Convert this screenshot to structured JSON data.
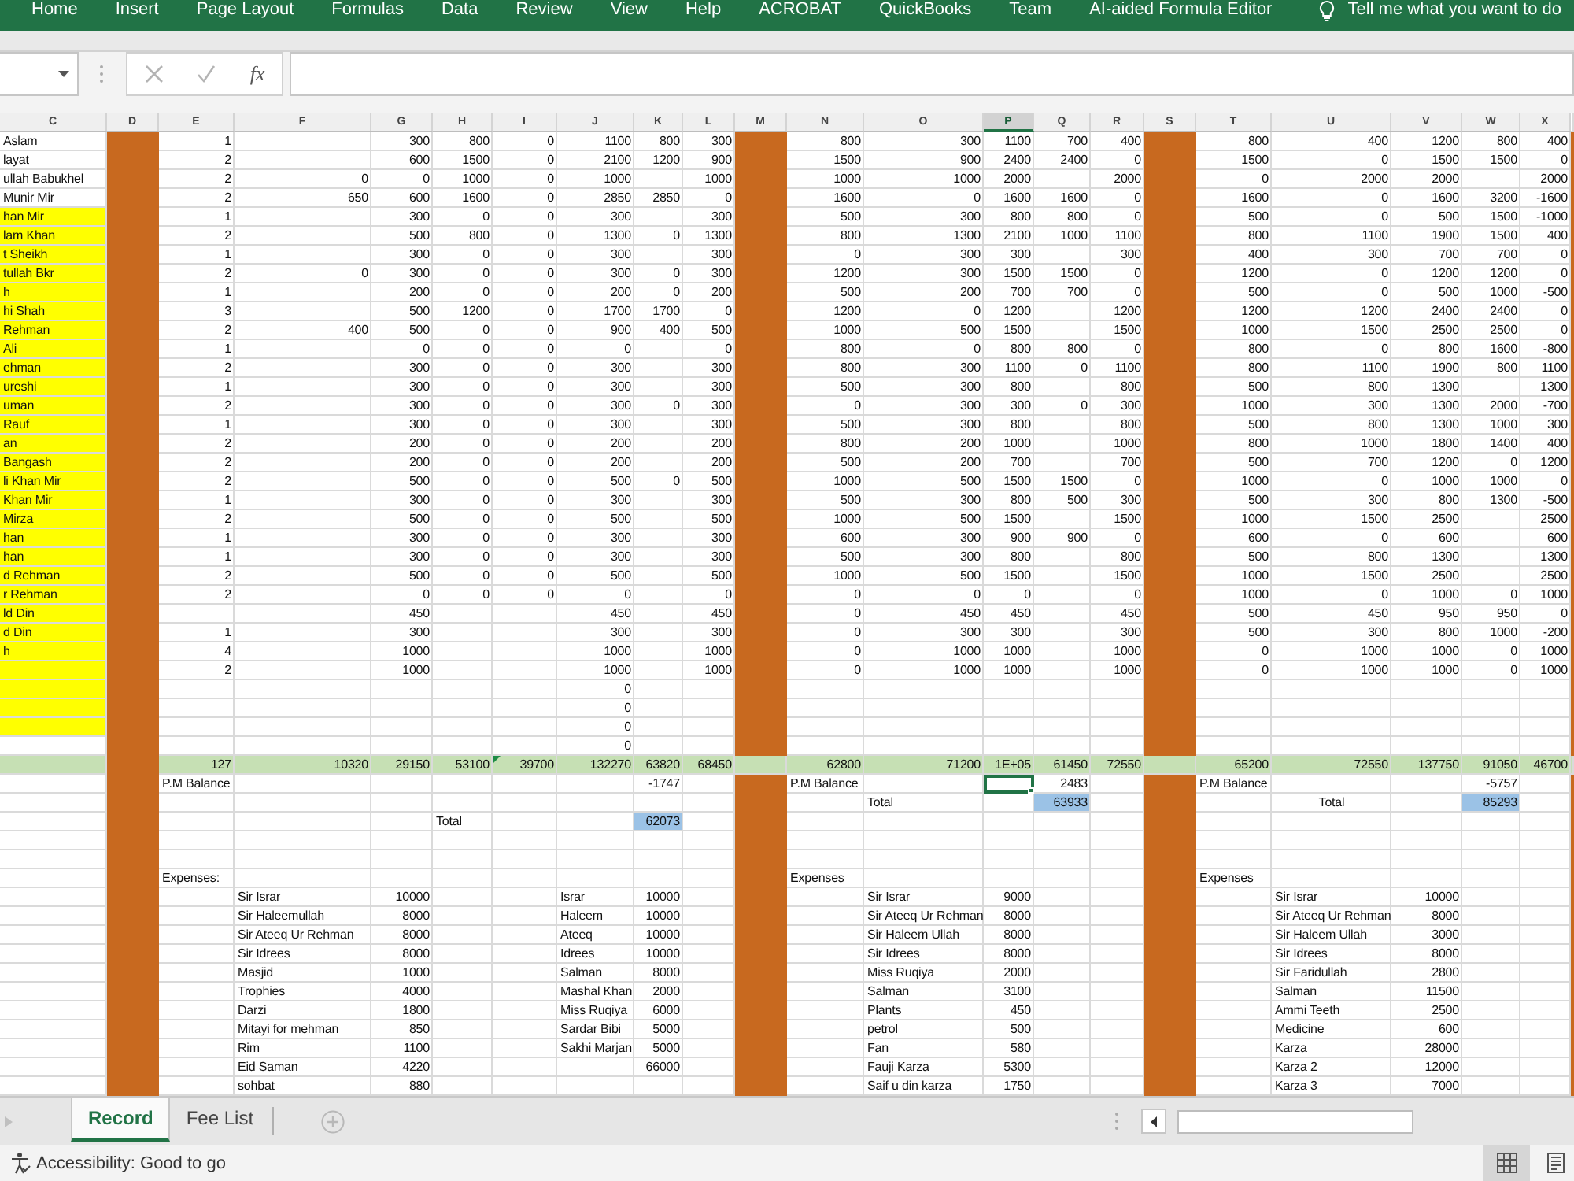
{
  "ribbon": {
    "tabs": [
      {
        "label": "Home",
        "selected": false
      },
      {
        "label": "Insert",
        "selected": false
      },
      {
        "label": "Page Layout",
        "selected": false
      },
      {
        "label": "Formulas",
        "selected": false
      },
      {
        "label": "Data",
        "selected": false
      },
      {
        "label": "Review",
        "selected": false
      },
      {
        "label": "View",
        "selected": false
      },
      {
        "label": "Help",
        "selected": false
      },
      {
        "label": "ACROBAT",
        "selected": false
      },
      {
        "label": "QuickBooks",
        "selected": false
      },
      {
        "label": "Team",
        "selected": false
      },
      {
        "label": "AI-aided Formula Editor",
        "selected": false
      }
    ],
    "tell_me": "Tell me what you want to do"
  },
  "formula_bar": {
    "function_label": "fx"
  },
  "sheet": {
    "columns": [
      {
        "label": "C",
        "kind": "text",
        "selected": false
      },
      {
        "label": "D",
        "kind": "divider",
        "interrupted_by_totals": false,
        "selected": false
      },
      {
        "label": "E",
        "kind": "number",
        "selected": false
      },
      {
        "label": "F",
        "kind": "number",
        "selected": false
      },
      {
        "label": "G",
        "kind": "number",
        "selected": false
      },
      {
        "label": "H",
        "kind": "number",
        "selected": false
      },
      {
        "label": "I",
        "kind": "number",
        "selected": false
      },
      {
        "label": "J",
        "kind": "number",
        "selected": false
      },
      {
        "label": "K",
        "kind": "number",
        "selected": false
      },
      {
        "label": "L",
        "kind": "number",
        "selected": false
      },
      {
        "label": "M",
        "kind": "divider",
        "interrupted_by_totals": true,
        "selected": false
      },
      {
        "label": "N",
        "kind": "number",
        "selected": false
      },
      {
        "label": "O",
        "kind": "number",
        "selected": false
      },
      {
        "label": "P",
        "kind": "number",
        "selected": true
      },
      {
        "label": "Q",
        "kind": "number",
        "selected": false
      },
      {
        "label": "R",
        "kind": "number",
        "selected": false
      },
      {
        "label": "S",
        "kind": "divider",
        "interrupted_by_totals": true,
        "selected": false
      },
      {
        "label": "T",
        "kind": "number",
        "selected": false
      },
      {
        "label": "U",
        "kind": "number",
        "selected": false
      },
      {
        "label": "V",
        "kind": "number",
        "selected": false
      },
      {
        "label": "W",
        "kind": "number",
        "selected": false
      },
      {
        "label": "X",
        "kind": "number",
        "selected": false
      },
      {
        "kind": "divider",
        "interrupted_by_totals": true
      }
    ],
    "rows": [
      {
        "kind": "entry",
        "cells": [
          "Aslam",
          "1",
          null,
          "300",
          "800",
          "0",
          "1100",
          "800",
          "300",
          "800",
          "300",
          "1100",
          "700",
          "400",
          "800",
          "400",
          "1200",
          "800",
          "400"
        ]
      },
      {
        "kind": "entry",
        "cells": [
          "layat",
          "2",
          null,
          "600",
          "1500",
          "0",
          "2100",
          "1200",
          "900",
          "1500",
          "900",
          "2400",
          "2400",
          "0",
          "1500",
          "0",
          "1500",
          "1500",
          "0"
        ]
      },
      {
        "kind": "entry",
        "cells": [
          "ullah Babukhel",
          "2",
          "0",
          "0",
          "1000",
          "0",
          "1000",
          null,
          "1000",
          "1000",
          "1000",
          "2000",
          null,
          "2000",
          "0",
          "2000",
          "2000",
          null,
          "2000"
        ]
      },
      {
        "kind": "entry",
        "cells": [
          "Munir Mir",
          "2",
          "650",
          "600",
          "1600",
          "0",
          "2850",
          "2850",
          "0",
          "1600",
          "0",
          "1600",
          "1600",
          "0",
          "1600",
          "0",
          "1600",
          "3200",
          "-1600"
        ]
      },
      {
        "kind": "entry",
        "cells": [
          {
            "text": "han Mir",
            "color": "#ffff00"
          },
          "1",
          null,
          "300",
          "0",
          "0",
          "300",
          null,
          "300",
          "500",
          "300",
          "800",
          "800",
          "0",
          "500",
          "0",
          "500",
          "1500",
          "-1000"
        ]
      },
      {
        "kind": "entry",
        "cells": [
          {
            "text": "lam Khan",
            "color": "#ffff00"
          },
          "2",
          null,
          "500",
          "800",
          "0",
          "1300",
          "0",
          "1300",
          "800",
          "1300",
          "2100",
          "1000",
          "1100",
          "800",
          "1100",
          "1900",
          "1500",
          "400"
        ]
      },
      {
        "kind": "entry",
        "cells": [
          {
            "text": "t Sheikh",
            "color": "#ffff00"
          },
          "1",
          null,
          "300",
          "0",
          "0",
          "300",
          null,
          "300",
          "0",
          "300",
          "300",
          null,
          "300",
          "400",
          "300",
          "700",
          "700",
          "0"
        ]
      },
      {
        "kind": "entry",
        "cells": [
          {
            "text": "tullah Bkr",
            "color": "#ffff00"
          },
          "2",
          "0",
          "300",
          "0",
          "0",
          "300",
          "0",
          "300",
          "1200",
          "300",
          "1500",
          "1500",
          "0",
          "1200",
          "0",
          "1200",
          "1200",
          "0"
        ]
      },
      {
        "kind": "entry",
        "cells": [
          {
            "text": "h",
            "color": "#ffff00"
          },
          "1",
          null,
          "200",
          "0",
          "0",
          "200",
          "0",
          "200",
          "500",
          "200",
          "700",
          "700",
          "0",
          "500",
          "0",
          "500",
          "1000",
          "-500"
        ]
      },
      {
        "kind": "entry",
        "cells": [
          {
            "text": "hi Shah",
            "color": "#ffff00"
          },
          "3",
          null,
          "500",
          "1200",
          "0",
          "1700",
          "1700",
          "0",
          "1200",
          "0",
          "1200",
          null,
          "1200",
          "1200",
          "1200",
          "2400",
          "2400",
          "0"
        ]
      },
      {
        "kind": "entry",
        "cells": [
          {
            "text": "Rehman",
            "color": "#ffff00"
          },
          "2",
          "400",
          "500",
          "0",
          "0",
          "900",
          "400",
          "500",
          "1000",
          "500",
          "1500",
          null,
          "1500",
          "1000",
          "1500",
          "2500",
          "2500",
          "0"
        ]
      },
      {
        "kind": "entry",
        "cells": [
          {
            "text": "Ali",
            "color": "#ffff00"
          },
          "1",
          null,
          "0",
          "0",
          "0",
          "0",
          null,
          "0",
          "800",
          "0",
          "800",
          "800",
          "0",
          "800",
          "0",
          "800",
          "1600",
          "-800"
        ]
      },
      {
        "kind": "entry",
        "cells": [
          {
            "text": "ehman",
            "color": "#ffff00"
          },
          "2",
          null,
          "300",
          "0",
          "0",
          "300",
          null,
          "300",
          "800",
          "300",
          "1100",
          "0",
          "1100",
          "800",
          "1100",
          "1900",
          "800",
          "1100"
        ]
      },
      {
        "kind": "entry",
        "cells": [
          {
            "text": "ureshi",
            "color": "#ffff00"
          },
          "1",
          null,
          "300",
          "0",
          "0",
          "300",
          null,
          "300",
          "500",
          "300",
          "800",
          null,
          "800",
          "500",
          "800",
          "1300",
          null,
          "1300"
        ]
      },
      {
        "kind": "entry",
        "cells": [
          {
            "text": "uman",
            "color": "#ffff00"
          },
          "2",
          null,
          "300",
          "0",
          "0",
          "300",
          "0",
          "300",
          "0",
          "300",
          "300",
          "0",
          "300",
          "1000",
          "300",
          "1300",
          "2000",
          "-700"
        ]
      },
      {
        "kind": "entry",
        "cells": [
          {
            "text": "Rauf",
            "color": "#ffff00"
          },
          "1",
          null,
          "300",
          "0",
          "0",
          "300",
          null,
          "300",
          "500",
          "300",
          "800",
          null,
          "800",
          "500",
          "800",
          "1300",
          "1000",
          "300"
        ]
      },
      {
        "kind": "entry",
        "cells": [
          {
            "text": "an",
            "color": "#ffff00"
          },
          "2",
          null,
          "200",
          "0",
          "0",
          "200",
          null,
          "200",
          "800",
          "200",
          "1000",
          null,
          "1000",
          "800",
          "1000",
          "1800",
          "1400",
          "400"
        ]
      },
      {
        "kind": "entry",
        "cells": [
          {
            "text": "Bangash",
            "color": "#ffff00"
          },
          "2",
          null,
          "200",
          "0",
          "0",
          "200",
          null,
          "200",
          "500",
          "200",
          "700",
          null,
          "700",
          "500",
          "700",
          "1200",
          "0",
          "1200"
        ]
      },
      {
        "kind": "entry",
        "cells": [
          {
            "text": "li Khan Mir",
            "color": "#ffff00"
          },
          "2",
          null,
          "500",
          "0",
          "0",
          "500",
          "0",
          "500",
          "1000",
          "500",
          "1500",
          "1500",
          "0",
          "1000",
          "0",
          "1000",
          "1000",
          "0"
        ]
      },
      {
        "kind": "entry",
        "cells": [
          {
            "text": "Khan Mir",
            "color": "#ffff00"
          },
          "1",
          null,
          "300",
          "0",
          "0",
          "300",
          null,
          "300",
          "500",
          "300",
          "800",
          "500",
          "300",
          "500",
          "300",
          "800",
          "1300",
          "-500"
        ]
      },
      {
        "kind": "entry",
        "cells": [
          {
            "text": "Mirza",
            "color": "#ffff00"
          },
          "2",
          null,
          "500",
          "0",
          "0",
          "500",
          null,
          "500",
          "1000",
          "500",
          "1500",
          null,
          "1500",
          "1000",
          "1500",
          "2500",
          null,
          "2500"
        ]
      },
      {
        "kind": "entry",
        "cells": [
          {
            "text": "han",
            "color": "#ffff00"
          },
          "1",
          null,
          "300",
          "0",
          "0",
          "300",
          null,
          "300",
          "600",
          "300",
          "900",
          "900",
          "0",
          "600",
          "0",
          "600",
          null,
          "600"
        ]
      },
      {
        "kind": "entry",
        "cells": [
          {
            "text": "han",
            "color": "#ffff00"
          },
          "1",
          null,
          "300",
          "0",
          "0",
          "300",
          null,
          "300",
          "500",
          "300",
          "800",
          null,
          "800",
          "500",
          "800",
          "1300",
          null,
          "1300"
        ]
      },
      {
        "kind": "entry",
        "cells": [
          {
            "text": "d Rehman",
            "color": "#ffff00"
          },
          "2",
          null,
          "500",
          "0",
          "0",
          "500",
          null,
          "500",
          "1000",
          "500",
          "1500",
          null,
          "1500",
          "1000",
          "1500",
          "2500",
          null,
          "2500"
        ]
      },
      {
        "kind": "entry",
        "cells": [
          {
            "text": "r Rehman",
            "color": "#ffff00"
          },
          "2",
          null,
          "0",
          "0",
          "0",
          "0",
          null,
          "0",
          "0",
          "0",
          "0",
          null,
          "0",
          "1000",
          "0",
          "1000",
          "0",
          "1000"
        ]
      },
      {
        "kind": "entry",
        "cells": [
          {
            "text": "ld Din",
            "color": "#ffff00"
          },
          null,
          null,
          "450",
          null,
          null,
          "450",
          null,
          "450",
          "0",
          "450",
          "450",
          null,
          "450",
          "500",
          "450",
          "950",
          "950",
          "0"
        ]
      },
      {
        "kind": "entry",
        "cells": [
          {
            "text": "d Din",
            "color": "#ffff00"
          },
          "1",
          null,
          "300",
          null,
          null,
          "300",
          null,
          "300",
          "0",
          "300",
          "300",
          null,
          "300",
          "500",
          "300",
          "800",
          "1000",
          "-200"
        ]
      },
      {
        "kind": "entry",
        "cells": [
          {
            "text": "h",
            "color": "#ffff00"
          },
          "4",
          null,
          "1000",
          null,
          null,
          "1000",
          null,
          "1000",
          "0",
          "1000",
          "1000",
          null,
          "1000",
          "0",
          "1000",
          "1000",
          "0",
          "1000"
        ]
      },
      {
        "kind": "entry",
        "cells": [
          {
            "color": "#ffff00"
          },
          "2",
          null,
          "1000",
          null,
          null,
          "1000",
          null,
          "1000",
          "0",
          "1000",
          "1000",
          null,
          "1000",
          "0",
          "1000",
          "1000",
          "0",
          "1000"
        ]
      },
      {
        "kind": "entry",
        "cells": [
          {
            "color": "#ffff00"
          },
          null,
          null,
          null,
          null,
          null,
          "0"
        ]
      },
      {
        "kind": "entry",
        "cells": [
          {
            "color": "#ffff00"
          },
          null,
          null,
          null,
          null,
          null,
          "0"
        ]
      },
      {
        "kind": "entry",
        "cells": [
          {
            "color": "#ffff00"
          },
          null,
          null,
          null,
          null,
          null,
          "0"
        ]
      },
      {
        "kind": "entry",
        "cells": [
          null,
          null,
          null,
          null,
          null,
          null,
          "0"
        ]
      },
      {
        "kind": "total",
        "cells": [
          null,
          "127",
          "10320",
          "29150",
          "53100",
          {
            "text": "39700",
            "flagged": true
          },
          "132270",
          "63820",
          "68450",
          "62800",
          "71200",
          "1E+05",
          "61450",
          "72550",
          "65200",
          "72550",
          "137750",
          "91050",
          "46700"
        ]
      },
      {
        "kind": "entry",
        "cells": [
          null,
          {
            "text": "P.M Balance",
            "kind": "label"
          },
          null,
          null,
          null,
          null,
          null,
          "-1747",
          null,
          {
            "text": "P.M Balance",
            "kind": "label"
          },
          null,
          {
            "selected": true
          },
          "2483",
          null,
          {
            "text": "P.M Balance",
            "kind": "label"
          },
          null,
          null,
          "-5757"
        ]
      },
      {
        "kind": "entry",
        "cells": [
          null,
          null,
          null,
          null,
          null,
          null,
          null,
          null,
          null,
          null,
          {
            "text": "Total",
            "kind": "label"
          },
          null,
          {
            "text": "63933",
            "color": "#9bc2e6"
          },
          null,
          null,
          {
            "text": "Total",
            "kind": "caption"
          },
          null,
          {
            "text": "85293",
            "color": "#9bc2e6"
          }
        ]
      },
      {
        "kind": "entry",
        "cells": [
          null,
          null,
          null,
          null,
          {
            "text": "Total",
            "kind": "label"
          },
          null,
          null,
          {
            "text": "62073",
            "color": "#9bc2e6"
          }
        ]
      },
      {
        "kind": "entry"
      },
      {
        "kind": "entry"
      },
      {
        "kind": "entry",
        "cells": [
          null,
          {
            "text": "Expenses:",
            "kind": "label"
          },
          null,
          null,
          null,
          null,
          null,
          null,
          null,
          {
            "text": "Expenses",
            "kind": "label"
          },
          null,
          null,
          null,
          null,
          {
            "text": "Expenses",
            "kind": "label"
          }
        ]
      },
      {
        "kind": "entry",
        "cells": [
          null,
          null,
          {
            "text": "Sir Israr",
            "kind": "label"
          },
          "10000",
          null,
          null,
          {
            "text": "Israr",
            "kind": "label"
          },
          "10000",
          null,
          null,
          {
            "text": "Sir Israr",
            "kind": "label"
          },
          "9000",
          null,
          null,
          null,
          {
            "text": "Sir Israr",
            "kind": "label"
          },
          "10000"
        ]
      },
      {
        "kind": "entry",
        "cells": [
          null,
          null,
          {
            "text": "Sir Haleemullah",
            "kind": "label"
          },
          "8000",
          null,
          null,
          {
            "text": "Haleem",
            "kind": "label"
          },
          "10000",
          null,
          null,
          {
            "text": "Sir Ateeq Ur Rehman",
            "kind": "label"
          },
          "8000",
          null,
          null,
          null,
          {
            "text": "Sir Ateeq Ur Rehman",
            "kind": "label"
          },
          "8000"
        ]
      },
      {
        "kind": "entry",
        "cells": [
          null,
          null,
          {
            "text": "Sir Ateeq Ur Rehman",
            "kind": "label"
          },
          "8000",
          null,
          null,
          {
            "text": "Ateeq",
            "kind": "label"
          },
          "10000",
          null,
          null,
          {
            "text": "Sir Haleem Ullah",
            "kind": "label"
          },
          "8000",
          null,
          null,
          null,
          {
            "text": "Sir Haleem Ullah",
            "kind": "label"
          },
          "3000"
        ]
      },
      {
        "kind": "entry",
        "cells": [
          null,
          null,
          {
            "text": "Sir Idrees",
            "kind": "label"
          },
          "8000",
          null,
          null,
          {
            "text": "Idrees",
            "kind": "label"
          },
          "10000",
          null,
          null,
          {
            "text": "Sir Idrees",
            "kind": "label"
          },
          "8000",
          null,
          null,
          null,
          {
            "text": "Sir Idrees",
            "kind": "label"
          },
          "8000"
        ]
      },
      {
        "kind": "entry",
        "cells": [
          null,
          null,
          {
            "text": "Masjid",
            "kind": "label"
          },
          "1000",
          null,
          null,
          {
            "text": "Salman",
            "kind": "label"
          },
          "8000",
          null,
          null,
          {
            "text": "Miss Ruqiya",
            "kind": "label"
          },
          "2000",
          null,
          null,
          null,
          {
            "text": "Sir Faridullah",
            "kind": "label"
          },
          "2800"
        ]
      },
      {
        "kind": "entry",
        "cells": [
          null,
          null,
          {
            "text": "Trophies",
            "kind": "label"
          },
          "4000",
          null,
          null,
          {
            "text": "Mashal Khan",
            "kind": "label"
          },
          "2000",
          null,
          null,
          {
            "text": "Salman",
            "kind": "label"
          },
          "3100",
          null,
          null,
          null,
          {
            "text": "Salman",
            "kind": "label"
          },
          "11500"
        ]
      },
      {
        "kind": "entry",
        "cells": [
          null,
          null,
          {
            "text": "Darzi",
            "kind": "label"
          },
          "1800",
          null,
          null,
          {
            "text": "Miss Ruqiya",
            "kind": "label"
          },
          "6000",
          null,
          null,
          {
            "text": "Plants",
            "kind": "label"
          },
          "450",
          null,
          null,
          null,
          {
            "text": "Ammi Teeth",
            "kind": "label"
          },
          "2500"
        ]
      },
      {
        "kind": "entry",
        "cells": [
          null,
          null,
          {
            "text": "Mitayi for mehman",
            "kind": "label"
          },
          "850",
          null,
          null,
          {
            "text": "Sardar Bibi",
            "kind": "label"
          },
          "5000",
          null,
          null,
          {
            "text": "petrol",
            "kind": "label"
          },
          "500",
          null,
          null,
          null,
          {
            "text": "Medicine",
            "kind": "label"
          },
          "600"
        ]
      },
      {
        "kind": "entry",
        "cells": [
          null,
          null,
          {
            "text": "Rim",
            "kind": "label"
          },
          "1100",
          null,
          null,
          {
            "text": "Sakhi Marjan",
            "kind": "label"
          },
          "5000",
          null,
          null,
          {
            "text": "Fan",
            "kind": "label"
          },
          "580",
          null,
          null,
          null,
          {
            "text": "Karza",
            "kind": "label"
          },
          "28000"
        ]
      },
      {
        "kind": "entry",
        "cells": [
          null,
          null,
          {
            "text": "Eid Saman",
            "kind": "label"
          },
          "4220",
          null,
          null,
          null,
          "66000",
          null,
          null,
          {
            "text": "Fauji Karza",
            "kind": "label"
          },
          "5300",
          null,
          null,
          null,
          {
            "text": "Karza 2",
            "kind": "label"
          },
          "12000"
        ]
      },
      {
        "kind": "entry",
        "cells": [
          null,
          null,
          {
            "text": "sohbat",
            "kind": "label"
          },
          "880",
          null,
          null,
          null,
          null,
          null,
          null,
          {
            "text": "Saif u din karza",
            "kind": "label"
          },
          "1750",
          null,
          null,
          null,
          {
            "text": "Karza 3",
            "kind": "label"
          },
          "7000"
        ]
      }
    ]
  },
  "sheet_tabs": [
    {
      "label": "Record",
      "selected": true
    },
    {
      "label": "Fee List",
      "selected": false
    }
  ],
  "status_bar": {
    "accessibility": "Accessibility: Good to go",
    "views": [
      {
        "kind": "normal",
        "selected": true
      },
      {
        "kind": "page_layout",
        "selected": false
      }
    ]
  }
}
